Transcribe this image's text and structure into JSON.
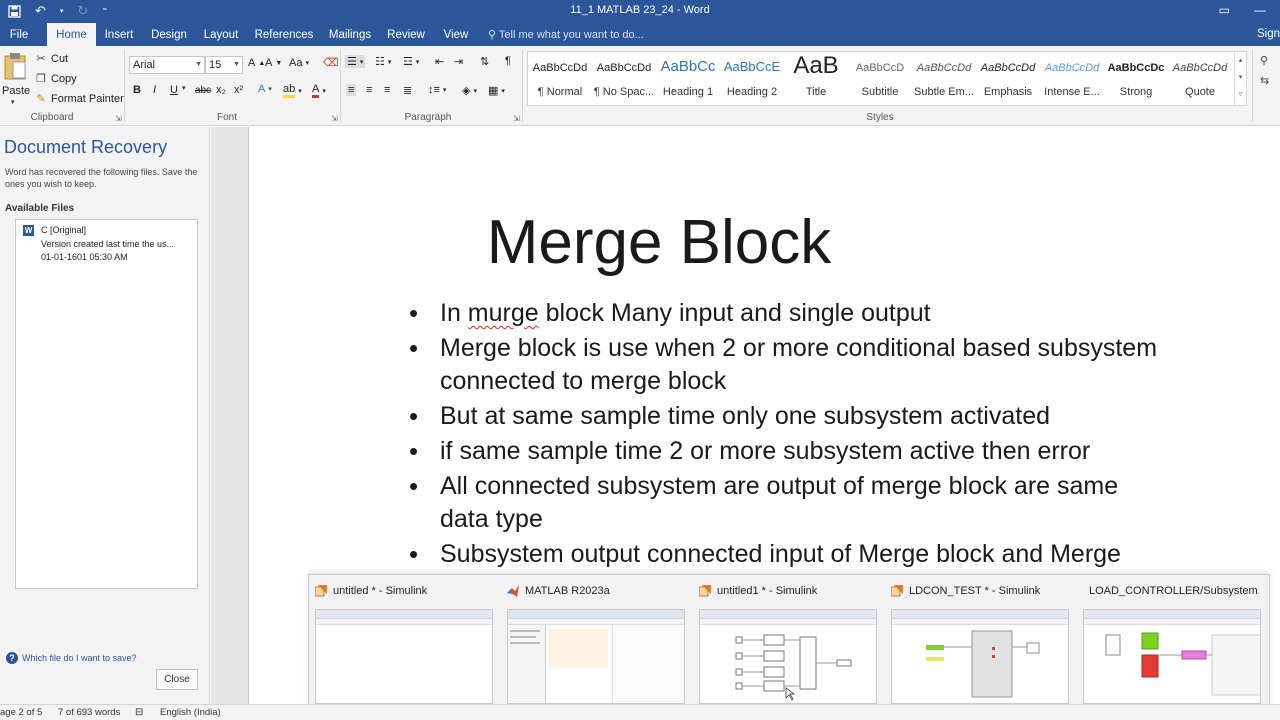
{
  "titlebar": {
    "title": "11_1 MATLAB  23_24 - Word",
    "qat": {
      "save_icon": "save-icon",
      "undo_icon": "undo-icon",
      "redo_icon": "redo-icon",
      "customize_icon": "customize-icon"
    }
  },
  "tabs": [
    {
      "label": "File"
    },
    {
      "label": "Home"
    },
    {
      "label": "Insert"
    },
    {
      "label": "Design"
    },
    {
      "label": "Layout"
    },
    {
      "label": "References"
    },
    {
      "label": "Mailings"
    },
    {
      "label": "Review"
    },
    {
      "label": "View"
    }
  ],
  "tellme": "Tell me what you want to do...",
  "signin": "Sign",
  "clipboard": {
    "paste": "Paste",
    "cut": "Cut",
    "copy": "Copy",
    "format_painter": "Format Painter",
    "label": "Clipboard"
  },
  "font": {
    "name": "Arial",
    "size": "15",
    "bold": "B",
    "italic": "I",
    "underline": "U",
    "strike": "abc",
    "sub": "x₂",
    "sup": "x²",
    "label": "Font"
  },
  "paragraph": {
    "label": "Paragraph"
  },
  "styles": {
    "label": "Styles",
    "items": [
      {
        "sample": "AaBbCcDd",
        "name": "¶ Normal"
      },
      {
        "sample": "AaBbCcDd",
        "name": "¶ No Spac..."
      },
      {
        "sample": "AaBbCc",
        "name": "Heading 1"
      },
      {
        "sample": "AaBbCcE",
        "name": "Heading 2"
      },
      {
        "sample": "AaB",
        "name": "Title"
      },
      {
        "sample": "AaBbCcD",
        "name": "Subtitle"
      },
      {
        "sample": "AaBbCcDd",
        "name": "Subtle Em..."
      },
      {
        "sample": "AaBbCcDd",
        "name": "Emphasis"
      },
      {
        "sample": "AaBbCcDd",
        "name": "Intense E..."
      },
      {
        "sample": "AaBbCcDc",
        "name": "Strong"
      },
      {
        "sample": "AaBbCcDd",
        "name": "Quote"
      }
    ]
  },
  "recovery": {
    "title": "Document Recovery",
    "description": "Word has recovered the following files.  Save the ones you wish to keep.",
    "available": "Available Files",
    "file": {
      "name": "C  [Original]",
      "desc": "Version created last time the us...",
      "date": "01-01-1601 05:30 AM"
    },
    "which_link": "Which file do I want to save?",
    "close": "Close"
  },
  "document": {
    "title": "Merge Block",
    "misspelled": "murge",
    "bullet1_pre": "In ",
    "bullet1_post": " block Many input and single output",
    "bullets": [
      "Merge block is use when 2 or more conditional based subsystem connected to merge block",
      "But at same sample time only one subsystem activated",
      "if same sample time 2 or more subsystem active then error",
      "All connected subsystem are output of merge block are same data type",
      "Subsystem output connected input of Merge block and Merge"
    ]
  },
  "taskbar_thumbs": [
    {
      "title": "untitled * - Simulink",
      "icon": "simulink-icon"
    },
    {
      "title": "MATLAB R2023a",
      "icon": "matlab-icon"
    },
    {
      "title": "untitled1 * - Simulink",
      "icon": "simulink-icon"
    },
    {
      "title": "LDCON_TEST * - Simulink",
      "icon": "simulink-icon"
    },
    {
      "title": "LOAD_CONTROLLER/Subsystem...",
      "icon": "simulink-icon"
    }
  ],
  "status": {
    "page": "age 2 of 5",
    "words": "7 of 693 words",
    "language": "English (India)"
  },
  "colors": {
    "accent": "#2b579a"
  }
}
